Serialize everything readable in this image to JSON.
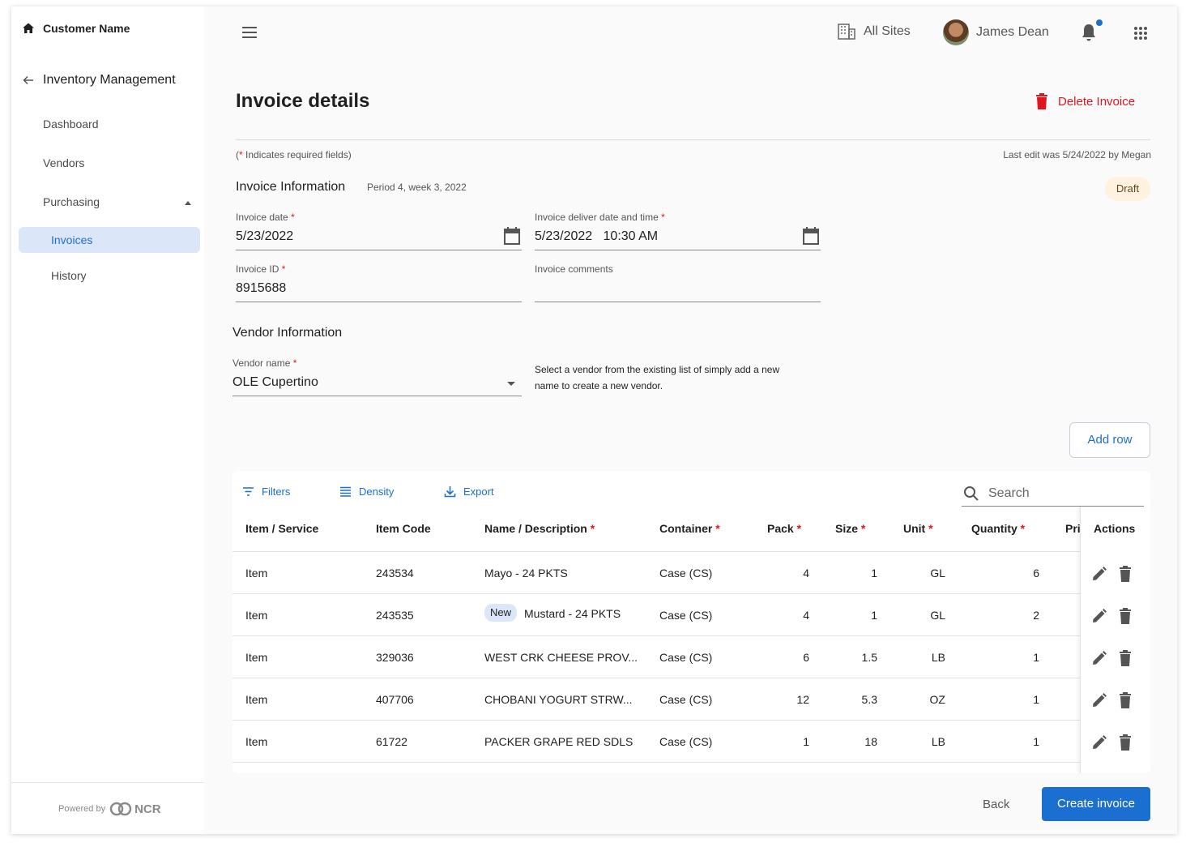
{
  "sidebar": {
    "customer": "Customer Name",
    "module": "Inventory Management",
    "items": [
      {
        "label": "Dashboard"
      },
      {
        "label": "Vendors"
      },
      {
        "label": "Purchasing"
      }
    ],
    "sub_items": [
      {
        "label": "Invoices",
        "active": true
      },
      {
        "label": "History",
        "active": false
      }
    ],
    "powered_by": "Powered by",
    "brand": "NCR"
  },
  "topbar": {
    "sites": "All Sites",
    "user_name": "James Dean"
  },
  "header": {
    "title": "Invoice details",
    "delete_label": "Delete Invoice",
    "required_note_prefix": "(",
    "required_note_star": "*",
    "required_note_text": " Indicates required fields)",
    "last_edit": "Last edit was 5/24/2022 by Megan"
  },
  "invoice": {
    "section_title": "Invoice Information",
    "period": "Period 4, week 3, 2022",
    "status": "Draft",
    "date_label": "Invoice date",
    "date_value": "5/23/2022",
    "deliver_label": "Invoice deliver date and time",
    "deliver_value": "5/23/2022   10:30 AM",
    "id_label": "Invoice ID",
    "id_value": "8915688",
    "comments_label": "Invoice comments",
    "comments_value": ""
  },
  "vendor": {
    "section_title": "Vendor Information",
    "name_label": "Vendor name",
    "name_value": "OLE Cupertino",
    "help": "Select a vendor from the existing list of simply add a new name to create a new vendor."
  },
  "table": {
    "add_row": "Add row",
    "tools": {
      "filters": "Filters",
      "density": "Density",
      "export": "Export"
    },
    "search_placeholder": "Search",
    "columns": {
      "item": "Item / Service",
      "code": "Item Code",
      "name": "Name / Description",
      "container": "Container",
      "pack": "Pack",
      "size": "Size",
      "unit": "Unit",
      "quantity": "Quantity",
      "price": "Pri",
      "actions": "Actions"
    },
    "new_badge": "New",
    "rows": [
      {
        "item": "Item",
        "code": "243534",
        "name": "Mayo - 24 PKTS",
        "container": "Case (CS)",
        "pack": "4",
        "size": "1",
        "unit": "GL",
        "quantity": "6"
      },
      {
        "item": "Item",
        "code": "243535",
        "name": "Mustard - 24 PKTS",
        "container": "Case (CS)",
        "pack": "4",
        "size": "1",
        "unit": "GL",
        "quantity": "2"
      },
      {
        "item": "Item",
        "code": "329036",
        "name": "WEST CRK CHEESE PROV...",
        "container": "Case (CS)",
        "pack": "6",
        "size": "1.5",
        "unit": "LB",
        "quantity": "1"
      },
      {
        "item": "Item",
        "code": "407706",
        "name": "CHOBANI YOGURT STRW...",
        "container": "Case (CS)",
        "pack": "12",
        "size": "5.3",
        "unit": "OZ",
        "quantity": "1"
      },
      {
        "item": "Item",
        "code": "61722",
        "name": "PACKER GRAPE RED SDLS",
        "container": "Case (CS)",
        "pack": "1",
        "size": "18",
        "unit": "LB",
        "quantity": "1"
      }
    ]
  },
  "footer": {
    "back": "Back",
    "create": "Create invoice"
  },
  "colors": {
    "accent": "#1a6fd1",
    "danger": "#e0161e",
    "draft_bg": "#fff3e0",
    "active_nav_bg": "#dbe7f9"
  }
}
